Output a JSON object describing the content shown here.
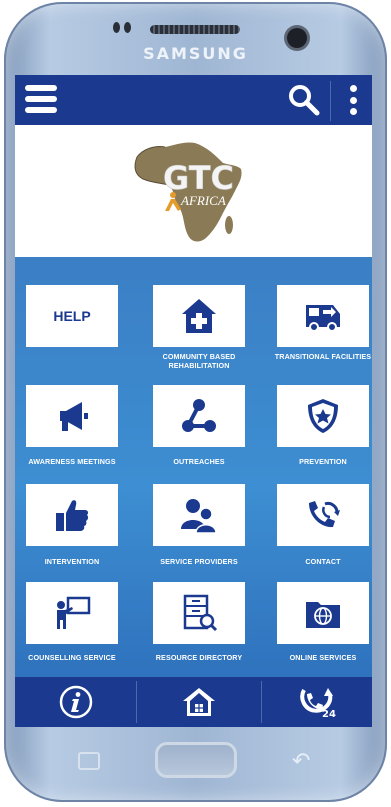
{
  "device": {
    "brand": "SAMSUNG"
  },
  "topbar": {
    "menu_icon": "hamburger-icon",
    "search_icon": "search-icon",
    "more_icon": "kebab-menu-icon"
  },
  "logo": {
    "text_main": "GTC",
    "text_sub": "AFRICA"
  },
  "tiles": [
    {
      "label": "",
      "title": "HELP",
      "icon": "help-text"
    },
    {
      "label": "COMMUNITY BASED REHABILITATION",
      "icon": "medical-house-icon"
    },
    {
      "label": "TRANSITIONAL FACILITIES",
      "icon": "van-icon"
    },
    {
      "label": "AWARENESS MEETINGS",
      "icon": "megaphone-icon"
    },
    {
      "label": "OUTREACHES",
      "icon": "share-nodes-icon"
    },
    {
      "label": "PREVENTION",
      "icon": "shield-star-icon"
    },
    {
      "label": "INTERVENTION",
      "icon": "thumbs-up-icon"
    },
    {
      "label": "SERVICE PROVIDERS",
      "icon": "people-icon"
    },
    {
      "label": "CONTACT",
      "icon": "phone-refresh-icon"
    },
    {
      "label": "COUNSELLING SERVICE",
      "icon": "presenter-board-icon"
    },
    {
      "label": "RESOURCE DIRECTORY",
      "icon": "cabinet-search-icon"
    },
    {
      "label": "ONLINE SERVICES",
      "icon": "globe-folder-icon"
    }
  ],
  "bottombar": {
    "info_icon": "info-icon",
    "home_icon": "home-icon",
    "support_icon": "support-24-icon",
    "support_badge": "24"
  },
  "colors": {
    "primary": "#1b3a8f",
    "grid_bg": "#3d8ed2",
    "tile_bg": "#ffffff",
    "label": "#ffffff"
  }
}
